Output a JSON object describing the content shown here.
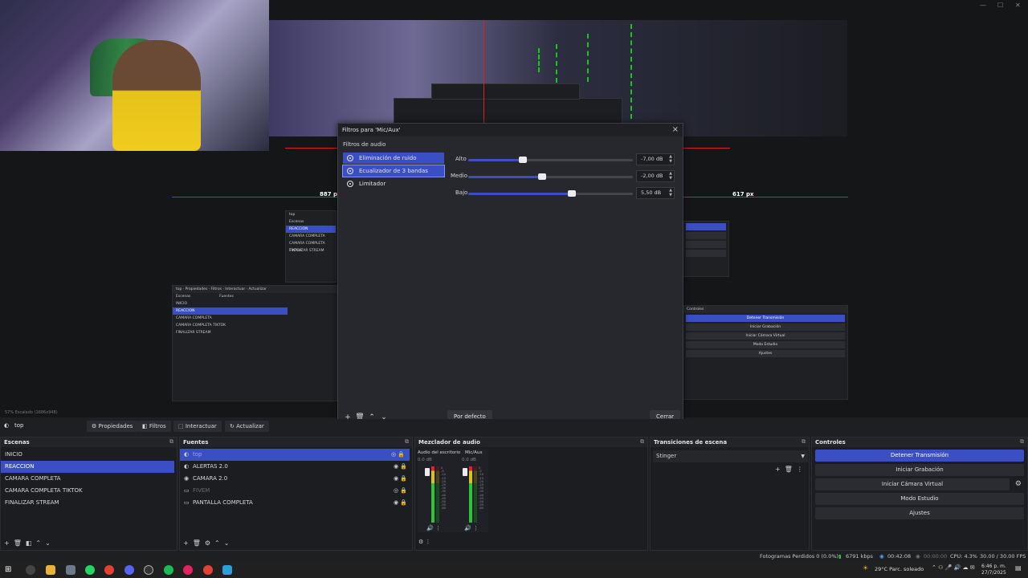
{
  "preview": {
    "label_left_px": "887 px",
    "label_right_px": "617 px",
    "zoom_info": "57%  Escalado (1686x948)"
  },
  "dialog": {
    "title": "Filtros para 'Mic/Aux'",
    "subtitle": "Filtros de audio",
    "filters": [
      {
        "name": "Eliminación de ruido"
      },
      {
        "name": "Ecualizador de 3 bandas"
      },
      {
        "name": "Limitador"
      }
    ],
    "eq": [
      {
        "label": "Alto",
        "value": "-7,00 dB",
        "level": 0.33
      },
      {
        "label": "Medio",
        "value": "-2,00 dB",
        "level": 0.45
      },
      {
        "label": "Bajo",
        "value": "5,50 dB",
        "level": 0.63
      }
    ],
    "default_button": "Por defecto",
    "close_button": "Cerrar"
  },
  "source_bar": {
    "source_name": "top",
    "properties": "Propiedades",
    "filters": "Filtros",
    "interact": "Interactuar",
    "refresh": "Actualizar"
  },
  "scenes": {
    "title": "Escenas",
    "items": [
      "INICIO",
      "REACCION",
      "CAMARA COMPLETA",
      "CAMARA COMPLETA TIKTOK",
      "FINALIZAR STREAM"
    ]
  },
  "sources": {
    "title": "Fuentes",
    "items": [
      "top",
      "ALERTAS 2.0",
      "CAMARA 2.0",
      "FIVEM",
      "PANTALLA COMPLETA"
    ]
  },
  "mixer": {
    "title": "Mezclador de audio",
    "channels": [
      {
        "name": "Audio del escritorio",
        "db": "0.0 dB"
      },
      {
        "name": "Mic/Aux",
        "db": "0.0 dB"
      }
    ],
    "scale": [
      "0",
      "-5",
      "-10",
      "-15",
      "-20",
      "-25",
      "-30",
      "-35",
      "-40",
      "-45",
      "-50",
      "-55",
      "-60"
    ]
  },
  "transitions": {
    "title": "Transiciones de escena",
    "selected": "Stinger"
  },
  "controls": {
    "title": "Controles",
    "stop_stream": "Detener Transmisión",
    "start_recording": "Iniciar Grabación",
    "start_virtualcam": "Iniciar Cámara Virtual",
    "studio_mode": "Modo Estudio",
    "settings": "Ajustes"
  },
  "status": {
    "dropped": "Fotogramas Perdidos 0 (0.0%)",
    "kbps": "6791 kbps",
    "stream_time": "00:42:08",
    "rec_time": "00:00:00",
    "cpu": "CPU: 4.3%",
    "fps": "30.00 / 30.00 FPS"
  },
  "taskbar": {
    "weather": "29°C  Parc. soleado",
    "time": "6:46 p. m.",
    "date": "27/7/2025"
  },
  "colors": {
    "accent": "#3b4fc4",
    "panel": "#1c1d21",
    "background": "#1e1f22"
  }
}
